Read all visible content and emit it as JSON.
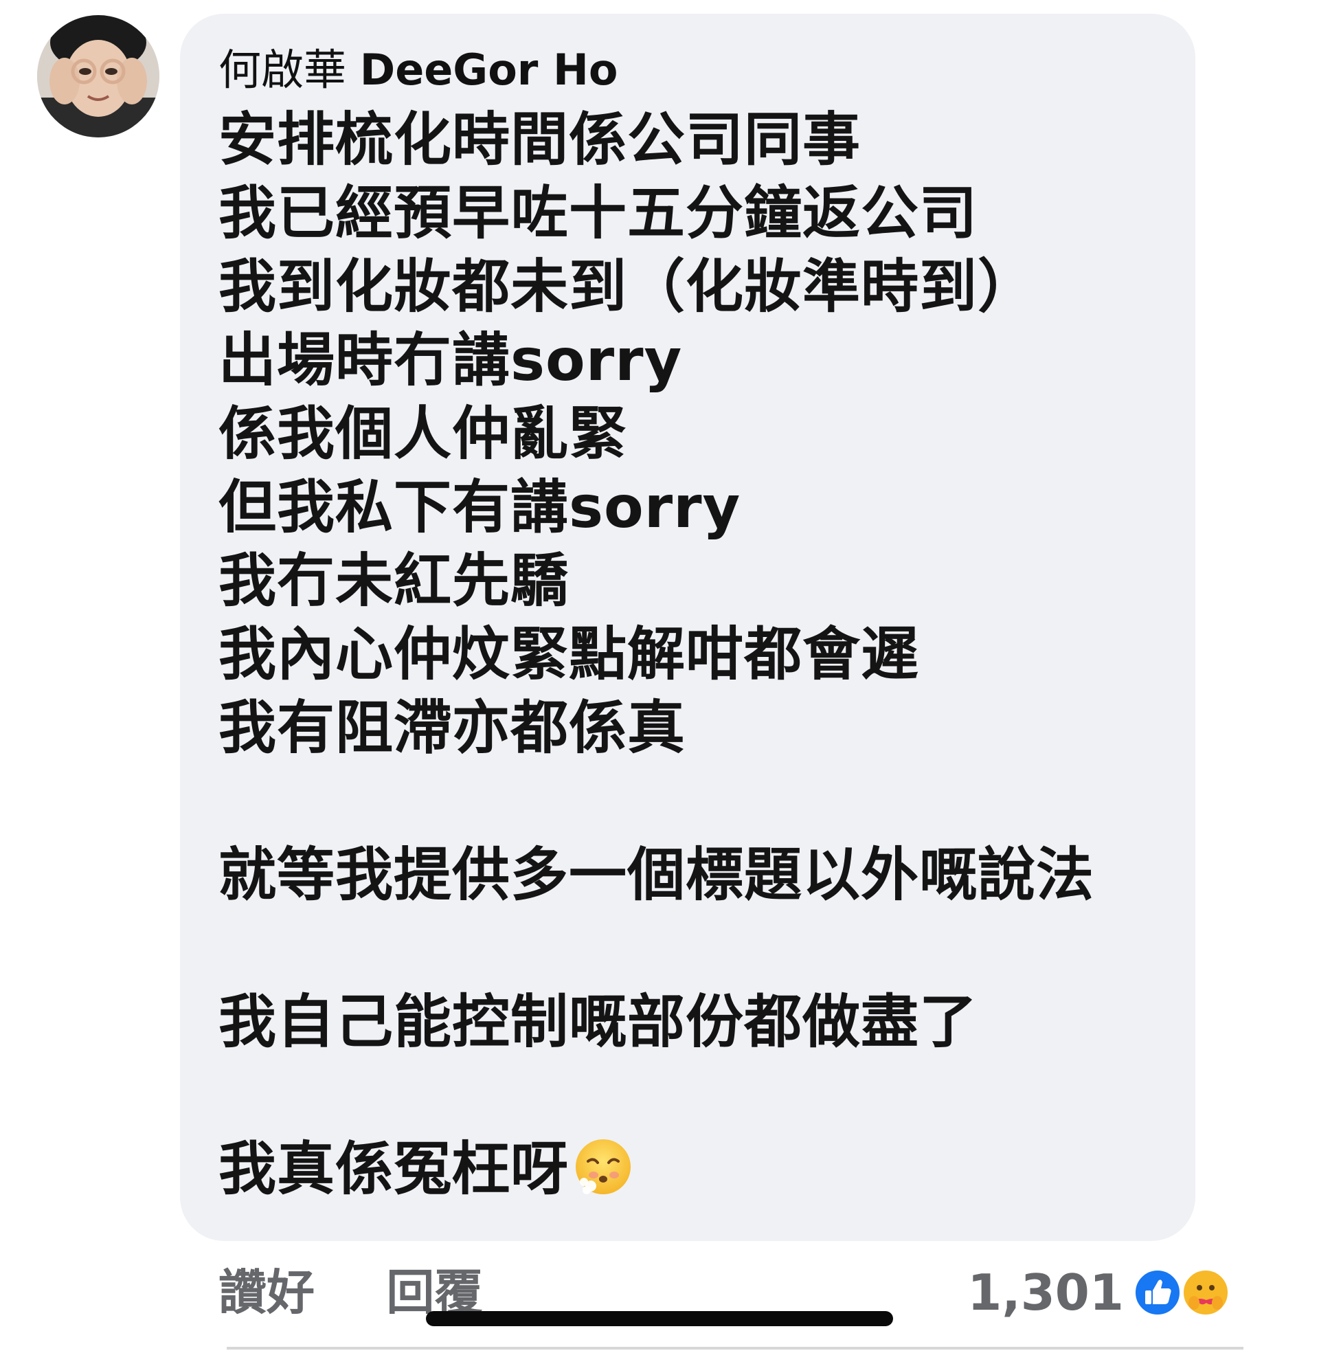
{
  "comment": {
    "author": {
      "name_cjk": "何啟華",
      "name_latin": "DeeGor Ho"
    },
    "lines": [
      "安排梳化時間係公司同事",
      "我已經預早咗十五分鐘返公司",
      "我到化妝都未到（化妝準時到）",
      "出場時冇講sorry",
      "係我個人仲亂緊",
      "但我私下有講sorry",
      "我冇未紅先驕",
      "我內心仲炆緊點解咁都會遲",
      "我有阻滯亦都係真",
      "",
      "就等我提供多一個標題以外嘅說法",
      "",
      "我自己能控制嘅部份都做盡了",
      "",
      "我真係冤枉呀"
    ],
    "last_line_emoji": "exhaling-face-icon"
  },
  "actions": {
    "like_label": "讚好",
    "reply_label": "回覆"
  },
  "reactions": {
    "count": "1,301",
    "icons": [
      "like-reaction-icon",
      "care-reaction-icon"
    ],
    "like_color": "#1877f2",
    "care_color": "#f7b928"
  }
}
